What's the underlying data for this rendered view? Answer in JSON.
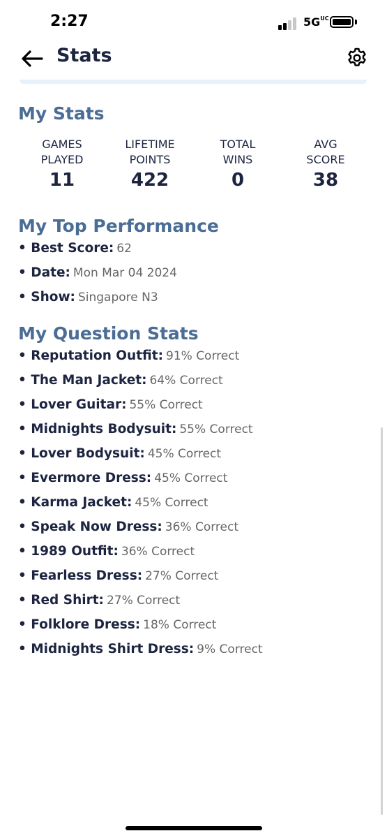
{
  "status_bar": {
    "time": "2:27",
    "network": "5G",
    "network_suffix": "UC"
  },
  "header": {
    "title": "Stats",
    "back_icon": "arrow-left-icon",
    "settings_icon": "gear-icon"
  },
  "my_stats": {
    "title": "My Stats",
    "items": [
      {
        "label_line1": "GAMES",
        "label_line2": "PLAYED",
        "value": "11"
      },
      {
        "label_line1": "LIFETIME",
        "label_line2": "POINTS",
        "value": "422"
      },
      {
        "label_line1": "TOTAL",
        "label_line2": "WINS",
        "value": "0"
      },
      {
        "label_line1": "AVG",
        "label_line2": "SCORE",
        "value": "38"
      }
    ]
  },
  "top_performance": {
    "title": "My Top Performance",
    "items": [
      {
        "label": "Best Score:",
        "value": "62"
      },
      {
        "label": "Date:",
        "value": "Mon Mar 04 2024"
      },
      {
        "label": "Show:",
        "value": "Singapore N3"
      }
    ]
  },
  "question_stats": {
    "title": "My Question Stats",
    "items": [
      {
        "label": "Reputation Outfit:",
        "value": "91% Correct"
      },
      {
        "label": "The Man Jacket:",
        "value": "64% Correct"
      },
      {
        "label": "Lover Guitar:",
        "value": "55% Correct"
      },
      {
        "label": "Midnights Bodysuit:",
        "value": "55% Correct"
      },
      {
        "label": "Lover Bodysuit:",
        "value": "45% Correct"
      },
      {
        "label": "Evermore Dress:",
        "value": "45% Correct"
      },
      {
        "label": "Karma Jacket:",
        "value": "45% Correct"
      },
      {
        "label": "Speak Now Dress:",
        "value": "36% Correct"
      },
      {
        "label": "1989 Outfit:",
        "value": "36% Correct"
      },
      {
        "label": "Fearless Dress:",
        "value": "27% Correct"
      },
      {
        "label": "Red Shirt:",
        "value": "27% Correct"
      },
      {
        "label": "Folklore Dress:",
        "value": "18% Correct"
      },
      {
        "label": "Midnights Shirt Dress:",
        "value": "9% Correct"
      }
    ]
  },
  "colors": {
    "heading": "#4a6c95",
    "text": "#1c2440",
    "muted": "#666666",
    "divider": "#e6f1f9"
  }
}
